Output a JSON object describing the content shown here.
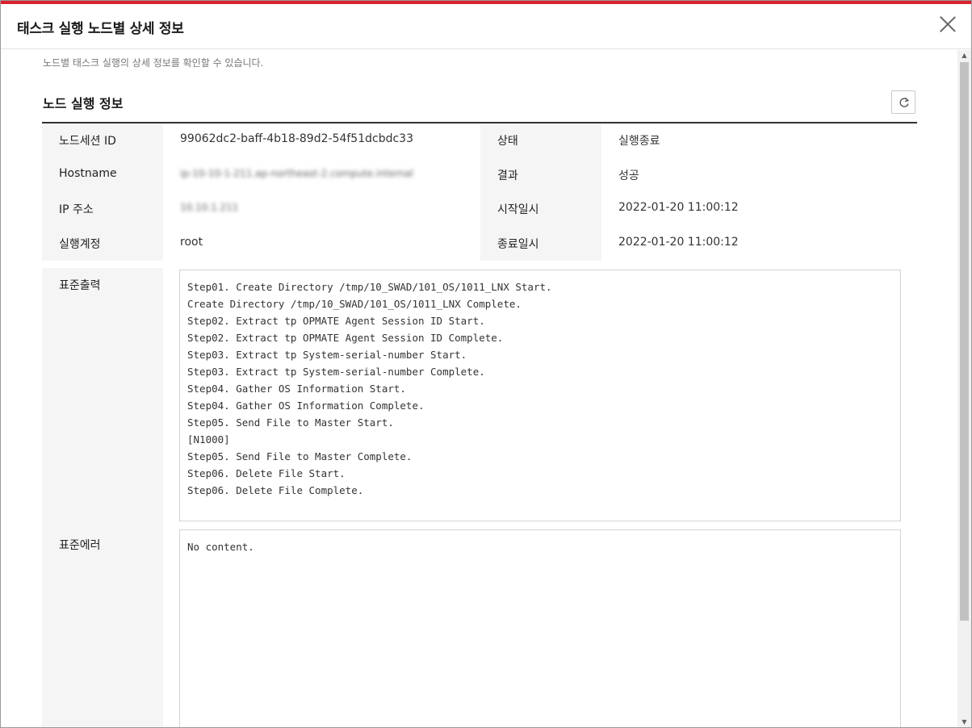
{
  "dialog": {
    "title": "태스크 실행 노드별 상세 정보",
    "close_icon": "close-icon"
  },
  "description": "노드별 태스크 실행의 상세 정보를 확인할 수 있습니다.",
  "section": {
    "title": "노드 실행 정보",
    "refresh_icon": "refresh-icon"
  },
  "info": {
    "session_label": "노드세션 ID",
    "session_value": "99062dc2-baff-4b18-89d2-54f51dcbdc33",
    "status_label": "상태",
    "status_value": "실행종료",
    "hostname_label": "Hostname",
    "hostname_value": "ip-10-10-1-211.ap-northeast-2.compute.internal",
    "result_label": "결과",
    "result_value": "성공",
    "ip_label": "IP 주소",
    "ip_value": "10.10.1.211",
    "start_label": "시작일시",
    "start_value": "2022-01-20 11:00:12",
    "account_label": "실행계정",
    "account_value": "root",
    "end_label": "종료일시",
    "end_value": "2022-01-20 11:00:12"
  },
  "stdout": {
    "label": "표준출력",
    "content": "Step01. Create Directory /tmp/10_SWAD/101_OS/1011_LNX Start.\nCreate Directory /tmp/10_SWAD/101_OS/1011_LNX Complete.\nStep02. Extract tp OPMATE Agent Session ID Start.\nStep02. Extract tp OPMATE Agent Session ID Complete.\nStep03. Extract tp System-serial-number Start.\nStep03. Extract tp System-serial-number Complete.\nStep04. Gather OS Information Start.\nStep04. Gather OS Information Complete.\nStep05. Send File to Master Start.\n[N1000]\nStep05. Send File to Master Complete.\nStep06. Delete File Start.\nStep06. Delete File Complete."
  },
  "stderr": {
    "label": "표준에러",
    "content": "No content."
  }
}
